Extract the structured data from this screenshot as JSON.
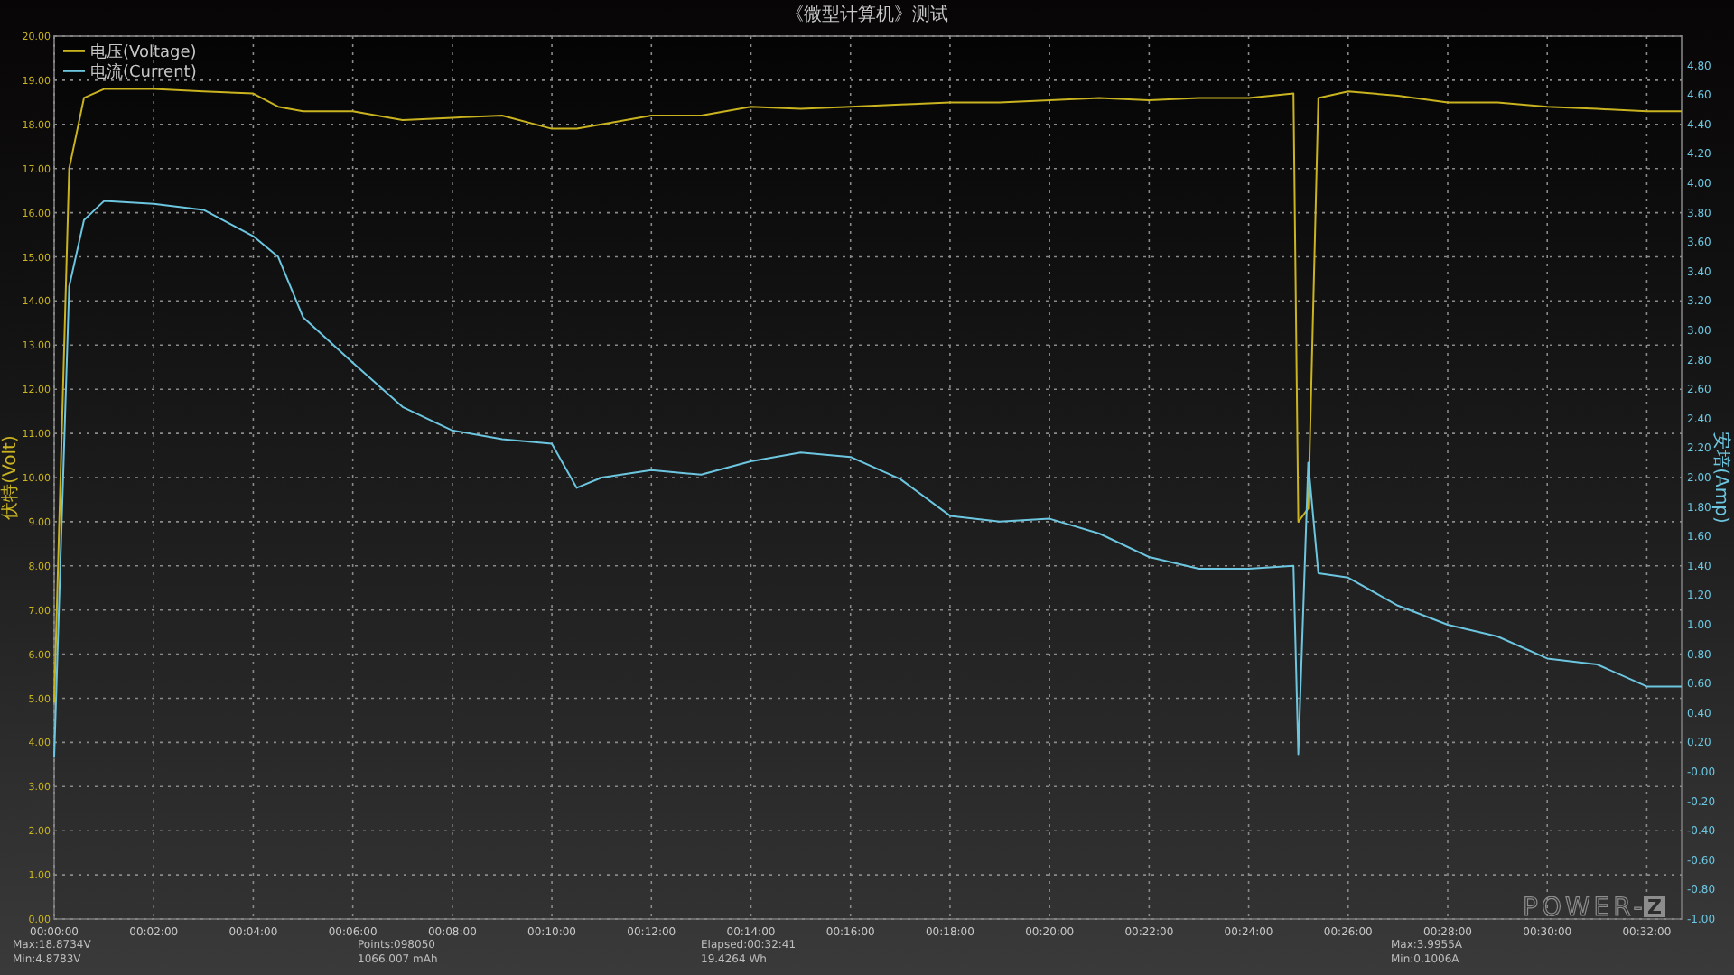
{
  "chart_data": {
    "type": "line",
    "title": "《微型计算机》测试",
    "ylabel": "伏特(Volt)",
    "y2label": "安培(Amp)",
    "x": [
      0,
      0.3,
      0.6,
      1,
      2,
      3,
      4,
      4.5,
      5,
      6,
      7,
      8,
      9,
      10,
      10.5,
      11,
      12,
      13,
      14,
      15,
      16,
      17,
      18,
      19,
      20,
      21,
      22,
      23,
      24,
      24.9,
      25.0,
      25.2,
      25.4,
      26,
      27,
      28,
      29,
      30,
      31,
      32,
      32.7
    ],
    "series": [
      {
        "name": "电压(Voltage)",
        "color": "#c9b420",
        "axis": "y",
        "values": [
          4.9,
          17,
          18.6,
          18.8,
          18.8,
          18.75,
          18.7,
          18.4,
          18.3,
          18.3,
          18.1,
          18.15,
          18.2,
          17.9,
          17.9,
          18.0,
          18.2,
          18.2,
          18.4,
          18.35,
          18.4,
          18.45,
          18.5,
          18.5,
          18.55,
          18.6,
          18.55,
          18.6,
          18.6,
          18.7,
          9.0,
          9.3,
          18.6,
          18.75,
          18.65,
          18.5,
          18.5,
          18.4,
          18.35,
          18.3,
          18.3
        ]
      },
      {
        "name": "电流(Current)",
        "color": "#6cc6e0",
        "axis": "y2",
        "values": [
          0.1,
          3.3,
          3.75,
          3.88,
          3.86,
          3.82,
          3.64,
          3.5,
          3.09,
          2.78,
          2.48,
          2.32,
          2.26,
          2.23,
          1.93,
          2.0,
          2.05,
          2.02,
          2.11,
          2.17,
          2.14,
          1.99,
          1.74,
          1.7,
          1.72,
          1.62,
          1.46,
          1.38,
          1.38,
          1.4,
          0.12,
          2.1,
          1.35,
          1.32,
          1.13,
          1.0,
          0.92,
          0.77,
          0.73,
          0.58,
          0.58
        ]
      }
    ],
    "grid": true,
    "legend": "upper left",
    "xlim": [
      0,
      32.7
    ],
    "ylim": [
      0,
      20
    ],
    "y2lim": [
      -1,
      5
    ],
    "xticks": [
      {
        "value": 0,
        "label": "00:00:00"
      },
      {
        "value": 2,
        "label": "00:02:00"
      },
      {
        "value": 4,
        "label": "00:04:00"
      },
      {
        "value": 6,
        "label": "00:06:00"
      },
      {
        "value": 8,
        "label": "00:08:00"
      },
      {
        "value": 10,
        "label": "00:10:00"
      },
      {
        "value": 12,
        "label": "00:12:00"
      },
      {
        "value": 14,
        "label": "00:14:00"
      },
      {
        "value": 16,
        "label": "00:16:00"
      },
      {
        "value": 18,
        "label": "00:18:00"
      },
      {
        "value": 20,
        "label": "00:20:00"
      },
      {
        "value": 22,
        "label": "00:22:00"
      },
      {
        "value": 24,
        "label": "00:24:00"
      },
      {
        "value": 26,
        "label": "00:26:00"
      },
      {
        "value": 28,
        "label": "00:28:00"
      },
      {
        "value": 30,
        "label": "00:30:00"
      },
      {
        "value": 32,
        "label": "00:32:00"
      }
    ],
    "yticks": [
      {
        "value": 0,
        "label": "0.00"
      },
      {
        "value": 1,
        "label": "1.00"
      },
      {
        "value": 2,
        "label": "2.00"
      },
      {
        "value": 3,
        "label": "3.00"
      },
      {
        "value": 4,
        "label": "4.00"
      },
      {
        "value": 5,
        "label": "5.00"
      },
      {
        "value": 6,
        "label": "6.00"
      },
      {
        "value": 7,
        "label": "7.00"
      },
      {
        "value": 8,
        "label": "8.00"
      },
      {
        "value": 9,
        "label": "9.00"
      },
      {
        "value": 10,
        "label": "10.00"
      },
      {
        "value": 11,
        "label": "11.00"
      },
      {
        "value": 12,
        "label": "12.00"
      },
      {
        "value": 13,
        "label": "13.00"
      },
      {
        "value": 14,
        "label": "14.00"
      },
      {
        "value": 15,
        "label": "15.00"
      },
      {
        "value": 16,
        "label": "16.00"
      },
      {
        "value": 17,
        "label": "17.00"
      },
      {
        "value": 18,
        "label": "18.00"
      },
      {
        "value": 19,
        "label": "19.00"
      },
      {
        "value": 20,
        "label": "20.00"
      }
    ],
    "y2ticks": [
      {
        "value": -1,
        "label": "-1.00"
      },
      {
        "value": -0.8,
        "label": "-0.80"
      },
      {
        "value": -0.6,
        "label": "-0.60"
      },
      {
        "value": -0.4,
        "label": "-0.40"
      },
      {
        "value": -0.2,
        "label": "-0.20"
      },
      {
        "value": 0,
        "label": "-0.00"
      },
      {
        "value": 0.2,
        "label": "0.20"
      },
      {
        "value": 0.4,
        "label": "0.40"
      },
      {
        "value": 0.6,
        "label": "0.60"
      },
      {
        "value": 0.8,
        "label": "0.80"
      },
      {
        "value": 1,
        "label": "1.00"
      },
      {
        "value": 1.2,
        "label": "1.20"
      },
      {
        "value": 1.4,
        "label": "1.40"
      },
      {
        "value": 1.6,
        "label": "1.60"
      },
      {
        "value": 1.8,
        "label": "1.80"
      },
      {
        "value": 2,
        "label": "2.00"
      },
      {
        "value": 2.2,
        "label": "2.20"
      },
      {
        "value": 2.4,
        "label": "2.40"
      },
      {
        "value": 2.6,
        "label": "2.60"
      },
      {
        "value": 2.8,
        "label": "2.80"
      },
      {
        "value": 3,
        "label": "3.00"
      },
      {
        "value": 3.2,
        "label": "3.20"
      },
      {
        "value": 3.4,
        "label": "3.40"
      },
      {
        "value": 3.6,
        "label": "3.60"
      },
      {
        "value": 3.8,
        "label": "3.80"
      },
      {
        "value": 4,
        "label": "4.00"
      },
      {
        "value": 4.2,
        "label": "4.20"
      },
      {
        "value": 4.4,
        "label": "4.40"
      },
      {
        "value": 4.6,
        "label": "4.60"
      },
      {
        "value": 4.8,
        "label": "4.80"
      }
    ]
  },
  "logo": {
    "text": "POWER-",
    "badge": "Z"
  },
  "stats": [
    [
      "Max:18.8734V",
      "Min:4.8783V"
    ],
    [
      "Points:098050",
      "1066.007 mAh"
    ],
    [
      "Elapsed:00:32:41",
      "19.4264 Wh"
    ],
    [
      "Max:3.9955A",
      "Min:0.1006A"
    ]
  ]
}
